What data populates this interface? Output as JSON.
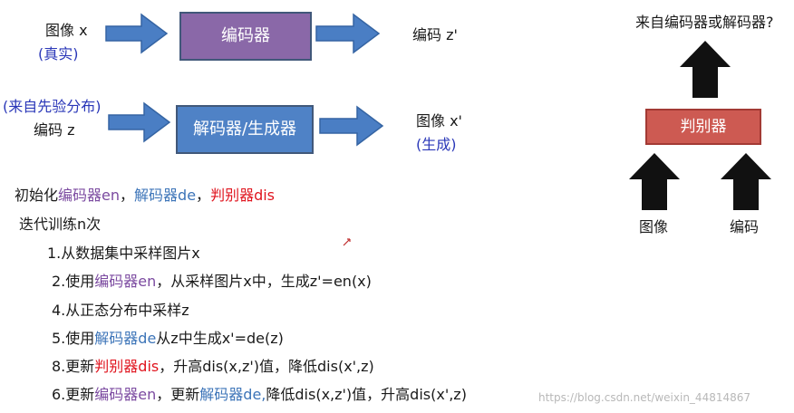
{
  "colors": {
    "blue_text": "#2a37b8",
    "encoder": "#8a68a8",
    "decoder": "#4f82c6",
    "discriminator": "#cd5a52",
    "red_text": "#e0141e",
    "arrow_blue": "#4a7ec4",
    "arrow_black": "#111111"
  },
  "top_row": {
    "input_label": "图像 x",
    "input_note": "(真实)",
    "box_label": "编码器",
    "output_label": "编码 z'"
  },
  "middle_row": {
    "input_note": "(来自先验分布)",
    "input_label": "编码 z",
    "box_label": "解码器/生成器",
    "output_label": "图像 x'",
    "output_note": "(生成)"
  },
  "discriminator": {
    "question": "来自编码器或解码器?",
    "box_label": "判别器",
    "input_image": "图像",
    "input_code": "编码"
  },
  "algorithm": {
    "init": {
      "prefix": "初始化",
      "enc": "编码器en",
      "sep1": "，",
      "dec": "解码器de",
      "sep2": "，",
      "dis": "判别器dis"
    },
    "loop": "迭代训练n次",
    "step1": "1.从数据集中采样图片x",
    "step2": {
      "a": "2.使用",
      "enc": "编码器en",
      "b": "，从采样图片x中，生成z'=en(x)"
    },
    "step4": "4.从正态分布中采样z",
    "step5": {
      "a": "5.使用",
      "dec": "解码器de",
      "b": "从z中生成x'=de(z)"
    },
    "step8": {
      "a": "8.更新",
      "dis": "判别器dis",
      "b": "，升高dis(x,z')值，降低dis(x',z)"
    },
    "step6": {
      "a": "6.更新",
      "enc": "编码器en",
      "b": "，更新",
      "dec": "解码器de,",
      "c": "降低dis(x,z')值，升高dis(x',z)"
    }
  },
  "watermark": "https://blog.csdn.net/weixin_44814867"
}
